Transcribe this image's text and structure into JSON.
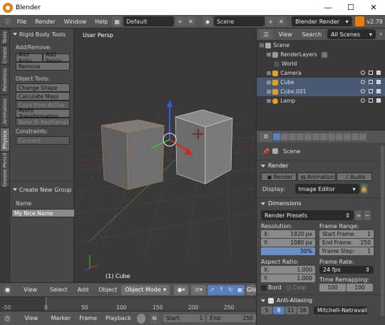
{
  "window": {
    "title": "Blender",
    "minimize": "—",
    "maximize": "☐",
    "close": "✕"
  },
  "infobar": {
    "menus": [
      "File",
      "Render",
      "Window",
      "Help"
    ],
    "layout": "Default",
    "scene": "Scene",
    "engine": "Blender Render",
    "version": "v2.78"
  },
  "toolshelf": {
    "tabs": [
      "Tools",
      "Create",
      "Relations",
      "Animation",
      "Physics",
      "Grease Pencil"
    ],
    "active_tab": "Physics",
    "panel_title": "Rigid Body Tools",
    "add_remove_label": "Add/Remove:",
    "add_active": "Add Activ",
    "add_passive": "Add Passiv",
    "remove": "Remove",
    "object_tools_label": "Object Tools:",
    "change_shape": "Change Shape",
    "calculate_mass": "Calculate Mass",
    "copy_from_active": "Copy from Active",
    "apply_transformation": "Apply Transformation",
    "bake_to_keyframes": "Bake To Keyframes",
    "constraints_label": "Constraints:",
    "connect": "Connect",
    "new_group_title": "Create New Group",
    "name_label": "Name",
    "name_value": "My Nice Name"
  },
  "viewport": {
    "label": "User Persp",
    "object": "(1) Cube"
  },
  "viewport_header": {
    "items": [
      "View",
      "Select",
      "Add",
      "Object"
    ],
    "mode": "Object Mode",
    "global": "Glo"
  },
  "timeline_ruler": {
    "ticks": [
      "-50",
      "0",
      "50",
      "100",
      "150",
      "200",
      "250"
    ]
  },
  "timeline_header": {
    "items": [
      "View",
      "Marker",
      "Frame",
      "Playback"
    ],
    "start_label": "Start:",
    "start_value": "1",
    "end_label": "End:",
    "end_value": "250"
  },
  "outliner": {
    "view": "View",
    "search": "Search",
    "filter": "All Scenes",
    "items": [
      {
        "name": "Scene",
        "indent": 0
      },
      {
        "name": "RenderLayers",
        "indent": 1
      },
      {
        "name": "World",
        "indent": 1
      },
      {
        "name": "Camera",
        "indent": 1
      },
      {
        "name": "Cube",
        "indent": 1
      },
      {
        "name": "Cube.001",
        "indent": 1
      },
      {
        "name": "Lamp",
        "indent": 1
      }
    ]
  },
  "properties": {
    "breadcrumb": "Scene",
    "render_title": "Render",
    "render_btn": "Render",
    "animation_btn": "Animation",
    "audio_btn": "Audio",
    "display_label": "Display:",
    "display_value": "Image Editor",
    "dimensions_title": "Dimensions",
    "presets": "Render Presets",
    "resolution_label": "Resolution:",
    "res_x_label": "X:",
    "res_x": "1920 px",
    "res_y_label": "Y:",
    "res_y": "1080 px",
    "res_pct": "50%",
    "frame_range_label": "Frame Range:",
    "start_frame_label": "Start Frame:",
    "start_frame": "1",
    "end_frame_label": "End Frame:",
    "end_frame": "250",
    "frame_step_label": "Frame Step:",
    "frame_step": "1",
    "aspect_label": "Aspect Ratio:",
    "asp_x_label": "X:",
    "asp_x": "1.000",
    "asp_y_label": "Y:",
    "asp_y": "1.000",
    "frame_rate_label": "Frame Rate:",
    "fps": "24 fps",
    "border_label": "Bord",
    "crop_label": "Crop",
    "time_remap_label": "Time Remapping:",
    "remap_old": "100",
    "remap_new": "100",
    "aa_title": "Anti-Aliasing",
    "aa_samples": [
      "5",
      "8",
      "11",
      "16"
    ],
    "aa_filter": "Mitchell-Netravali"
  },
  "colors": {
    "accent": "#e87d0d",
    "selected_blue": "#5680c2",
    "scene_bg": "#393939"
  }
}
